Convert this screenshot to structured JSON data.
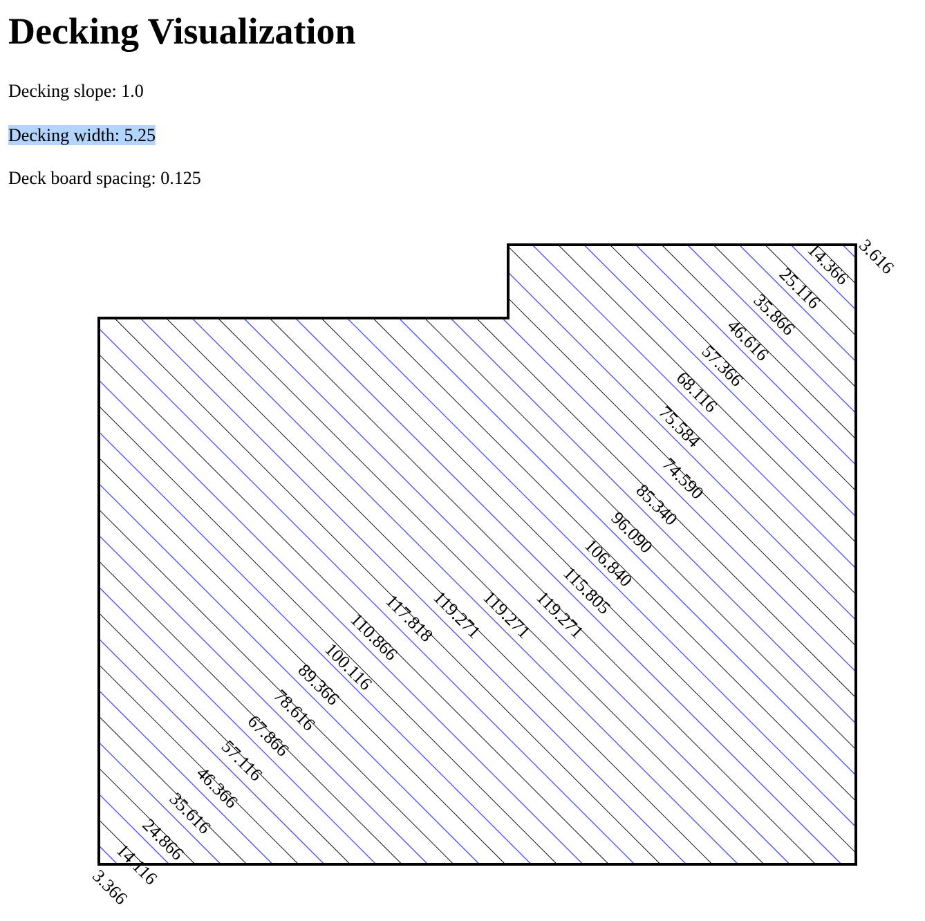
{
  "page": {
    "title": "Decking Visualization",
    "params": [
      {
        "label": "Decking slope:",
        "value": "1.0"
      },
      {
        "label": "Decking width:",
        "value": "5.25"
      },
      {
        "label": "Deck board spacing:",
        "value": "0.125"
      }
    ]
  },
  "colors": {
    "outline": "#000000",
    "board_edge_blue": "#4a4aff",
    "board_edge_black": "#000000",
    "selection": "#b3d4fc"
  },
  "diagram": {
    "board_lengths_lower_left": [
      "3.366",
      "14.116",
      "24.866",
      "35.616",
      "46.366",
      "57.116",
      "67.866",
      "78.616",
      "89.366",
      "100.116",
      "110.866",
      "117.818",
      "119.271",
      "119.271",
      "119.271",
      "115.805",
      "106.840",
      "96.090",
      "85.340",
      "74.590"
    ],
    "board_lengths_upper_right": [
      "3.616",
      "14.366",
      "25.116",
      "35.866",
      "46.616",
      "57.366",
      "68.116",
      "75.584"
    ]
  }
}
